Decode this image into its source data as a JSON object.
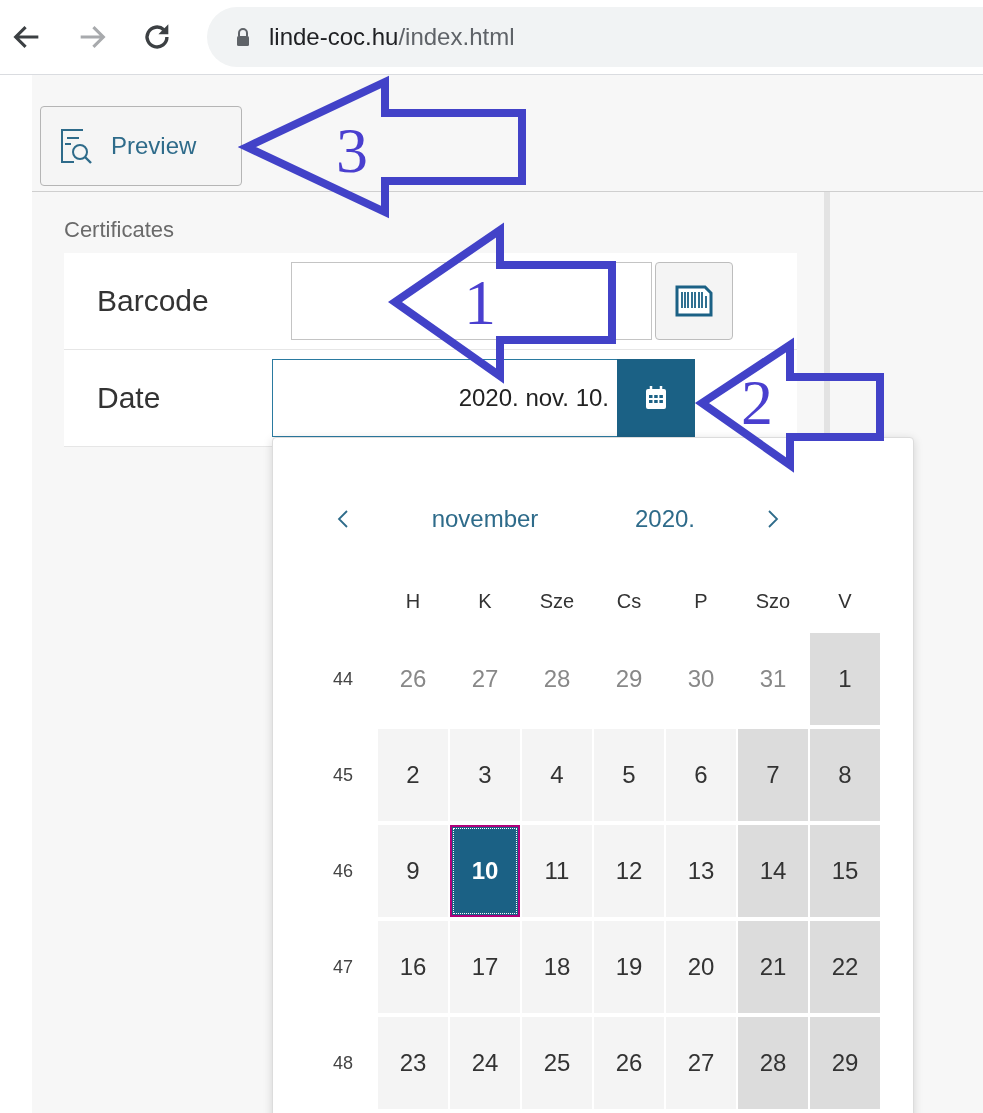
{
  "browser": {
    "nav": [
      {
        "kind": "back",
        "disabled": false
      },
      {
        "kind": "forward",
        "disabled": true
      },
      {
        "kind": "reload",
        "disabled": false
      }
    ],
    "url_host": "linde-coc.hu",
    "url_path": "/index.html"
  },
  "toolbar": {
    "preview_button": "Preview"
  },
  "section_title": "Certificates",
  "form": [
    {
      "kind": "barcode",
      "label": "Barcode"
    },
    {
      "kind": "date",
      "label": "Date",
      "value": "2020. nov. 10."
    }
  ],
  "calendar": {
    "month": "november",
    "year": "2020.",
    "weekdays": [
      "H",
      "K",
      "Sze",
      "Cs",
      "P",
      "Szo",
      "V"
    ],
    "weeks": [
      {
        "number": "44",
        "days": [
          {
            "label": "26",
            "kind": "other",
            "selected": false
          },
          {
            "label": "27",
            "kind": "other",
            "selected": false
          },
          {
            "label": "28",
            "kind": "other",
            "selected": false
          },
          {
            "label": "29",
            "kind": "other",
            "selected": false
          },
          {
            "label": "30",
            "kind": "other",
            "selected": false
          },
          {
            "label": "31",
            "kind": "other",
            "selected": false
          },
          {
            "label": "1",
            "kind": "weekend",
            "selected": false
          }
        ]
      },
      {
        "number": "45",
        "days": [
          {
            "label": "2",
            "kind": "weekday",
            "selected": false
          },
          {
            "label": "3",
            "kind": "weekday",
            "selected": false
          },
          {
            "label": "4",
            "kind": "weekday",
            "selected": false
          },
          {
            "label": "5",
            "kind": "weekday",
            "selected": false
          },
          {
            "label": "6",
            "kind": "weekday",
            "selected": false
          },
          {
            "label": "7",
            "kind": "weekend",
            "selected": false
          },
          {
            "label": "8",
            "kind": "weekend",
            "selected": false
          }
        ]
      },
      {
        "number": "46",
        "days": [
          {
            "label": "9",
            "kind": "weekday",
            "selected": false
          },
          {
            "label": "10",
            "kind": "weekday",
            "selected": true
          },
          {
            "label": "11",
            "kind": "weekday",
            "selected": false
          },
          {
            "label": "12",
            "kind": "weekday",
            "selected": false
          },
          {
            "label": "13",
            "kind": "weekday",
            "selected": false
          },
          {
            "label": "14",
            "kind": "weekend",
            "selected": false
          },
          {
            "label": "15",
            "kind": "weekend",
            "selected": false
          }
        ]
      },
      {
        "number": "47",
        "days": [
          {
            "label": "16",
            "kind": "weekday",
            "selected": false
          },
          {
            "label": "17",
            "kind": "weekday",
            "selected": false
          },
          {
            "label": "18",
            "kind": "weekday",
            "selected": false
          },
          {
            "label": "19",
            "kind": "weekday",
            "selected": false
          },
          {
            "label": "20",
            "kind": "weekday",
            "selected": false
          },
          {
            "label": "21",
            "kind": "weekend",
            "selected": false
          },
          {
            "label": "22",
            "kind": "weekend",
            "selected": false
          }
        ]
      },
      {
        "number": "48",
        "days": [
          {
            "label": "23",
            "kind": "weekday",
            "selected": false
          },
          {
            "label": "24",
            "kind": "weekday",
            "selected": false
          },
          {
            "label": "25",
            "kind": "weekday",
            "selected": false
          },
          {
            "label": "26",
            "kind": "weekday",
            "selected": false
          },
          {
            "label": "27",
            "kind": "weekday",
            "selected": false
          },
          {
            "label": "28",
            "kind": "weekend",
            "selected": false
          },
          {
            "label": "29",
            "kind": "weekend",
            "selected": false
          }
        ]
      }
    ]
  },
  "annotations": [
    {
      "number": "3"
    },
    {
      "number": "1"
    },
    {
      "number": "2"
    }
  ]
}
